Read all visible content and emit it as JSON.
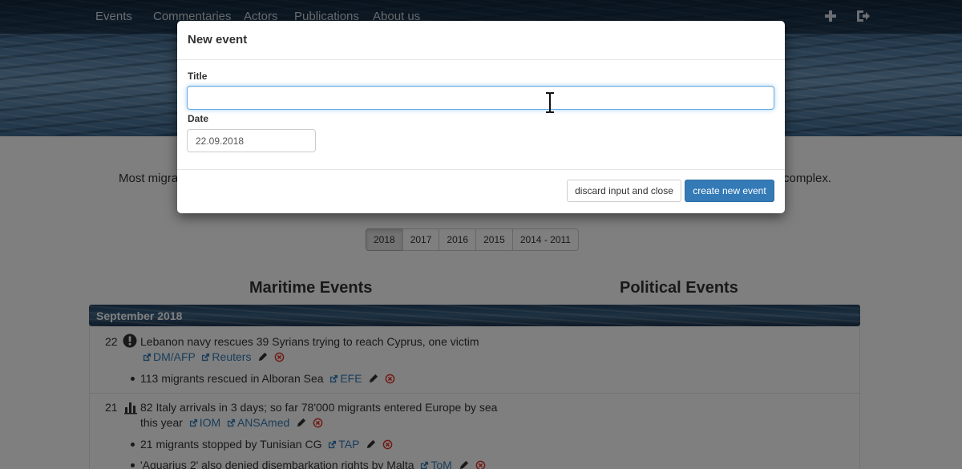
{
  "nav": {
    "items": [
      "Events",
      "Commentaries",
      "Actors",
      "Publications",
      "About us"
    ],
    "icons": [
      "plus-icon",
      "logout-icon"
    ]
  },
  "intro": {
    "left": "Most migra",
    "right": "complex."
  },
  "years": [
    "2018",
    "2017",
    "2016",
    "2015",
    "2014 - 2011"
  ],
  "active_year": "2018",
  "columns": {
    "maritime": "Maritime Events",
    "political": "Political Events"
  },
  "month": "September 2018",
  "events": {
    "e1": {
      "day": "22",
      "icon": "exclamation-circle-icon",
      "text": "Lebanon navy rescues 39 Syrians trying to reach Cyprus, one victim",
      "sources": [
        "DM/AFP",
        "Reuters"
      ]
    },
    "e2": {
      "text": "113 migrants rescued in Alboran Sea",
      "sources": [
        "EFE"
      ]
    },
    "e3": {
      "day": "21",
      "icon": "bar-chart-icon",
      "text1": "82 Italy arrivals in 3 days; so far 78'000 migrants entered Europe by sea",
      "text2": "this year",
      "sources": [
        "IOM",
        "ANSAmed"
      ]
    },
    "e4": {
      "text": "21 migrants stopped by Tunisian CG",
      "sources": [
        "TAP"
      ]
    },
    "e5": {
      "text": "'Aquarius 2' also denied disembarkation rights by Malta",
      "sources": [
        "ToM"
      ]
    }
  },
  "modal": {
    "title": "New event",
    "title_label": "Title",
    "title_value": "",
    "date_label": "Date",
    "date_value": "22.09.2018",
    "discard_label": "discard input and close",
    "create_label": "create new event"
  },
  "colors": {
    "primary": "#337ab7",
    "link": "#337ab7",
    "danger": "#e0352b"
  }
}
